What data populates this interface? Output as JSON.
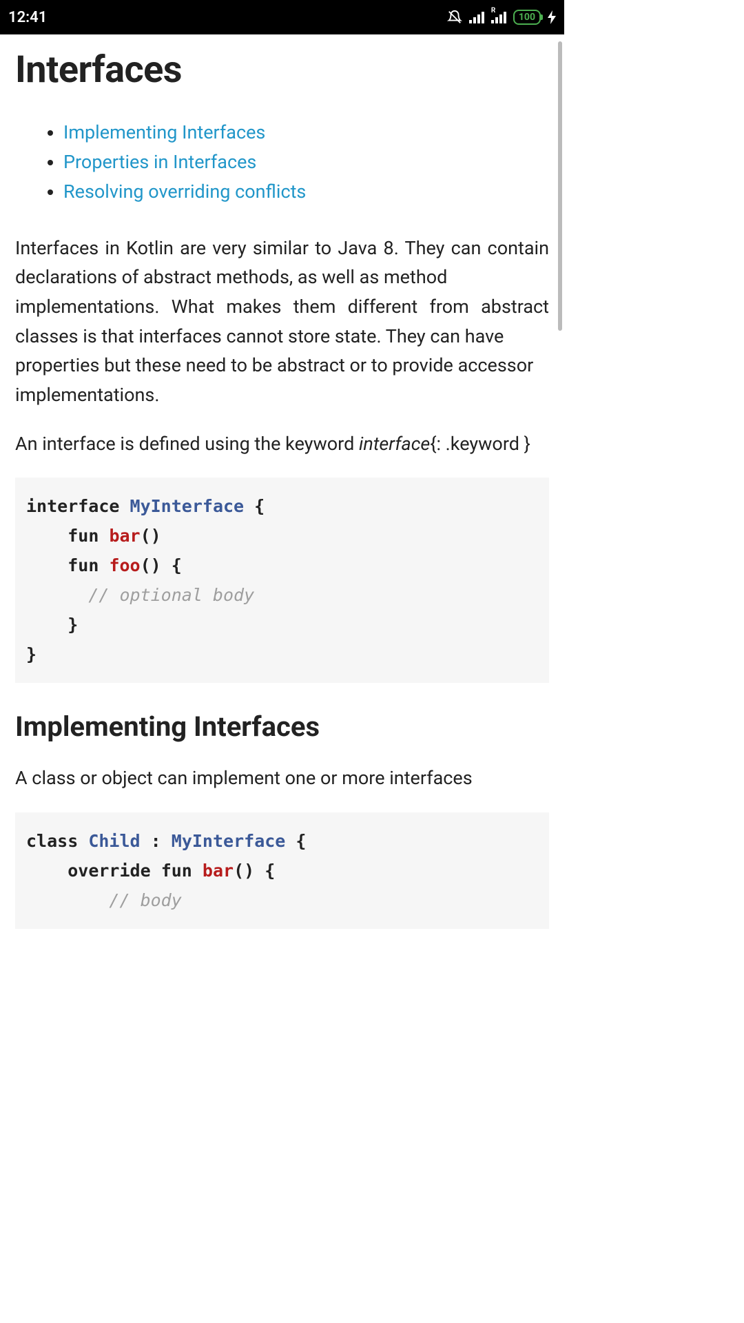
{
  "status": {
    "time": "12:41",
    "battery": "100",
    "roaming": "R"
  },
  "page": {
    "title": "Interfaces",
    "toc": [
      "Implementing Interfaces",
      "Properties in Interfaces",
      "Resolving overriding conflicts"
    ],
    "para1a": "Interfaces in Kotlin are very similar to Java 8. They can contain declarations of abstract methods, as well as method",
    "para1b": "implementations. What makes them different from abstract classes is that interfaces cannot store state. They can have",
    "para1c": "properties but these need to be abstract or to provide accessor implementations.",
    "para2_pre": "An interface is defined using the keyword ",
    "para2_kw": "interface",
    "para2_post": "{: .keyword }",
    "code1": {
      "kw_interface": "interface",
      "typ_myinterface": "MyInterface",
      "brace_open": "{",
      "kw_fun1": "fun",
      "fn_bar": "bar",
      "parens1": "()",
      "kw_fun2": "fun",
      "fn_foo": "foo",
      "parens2": "()",
      "brace_open2": "{",
      "comment": "// optional body",
      "brace_close2": "}",
      "brace_close": "}"
    },
    "h2_impl": "Implementing Interfaces",
    "para3": "A class or object can implement one or more interfaces",
    "code2": {
      "kw_class": "class",
      "typ_child": "Child",
      "colon": ":",
      "typ_myinterface": "MyInterface",
      "brace_open": "{",
      "kw_override": "override",
      "kw_fun": "fun",
      "fn_bar": "bar",
      "parens": "()",
      "brace_open2": "{",
      "comment": "// body"
    }
  }
}
